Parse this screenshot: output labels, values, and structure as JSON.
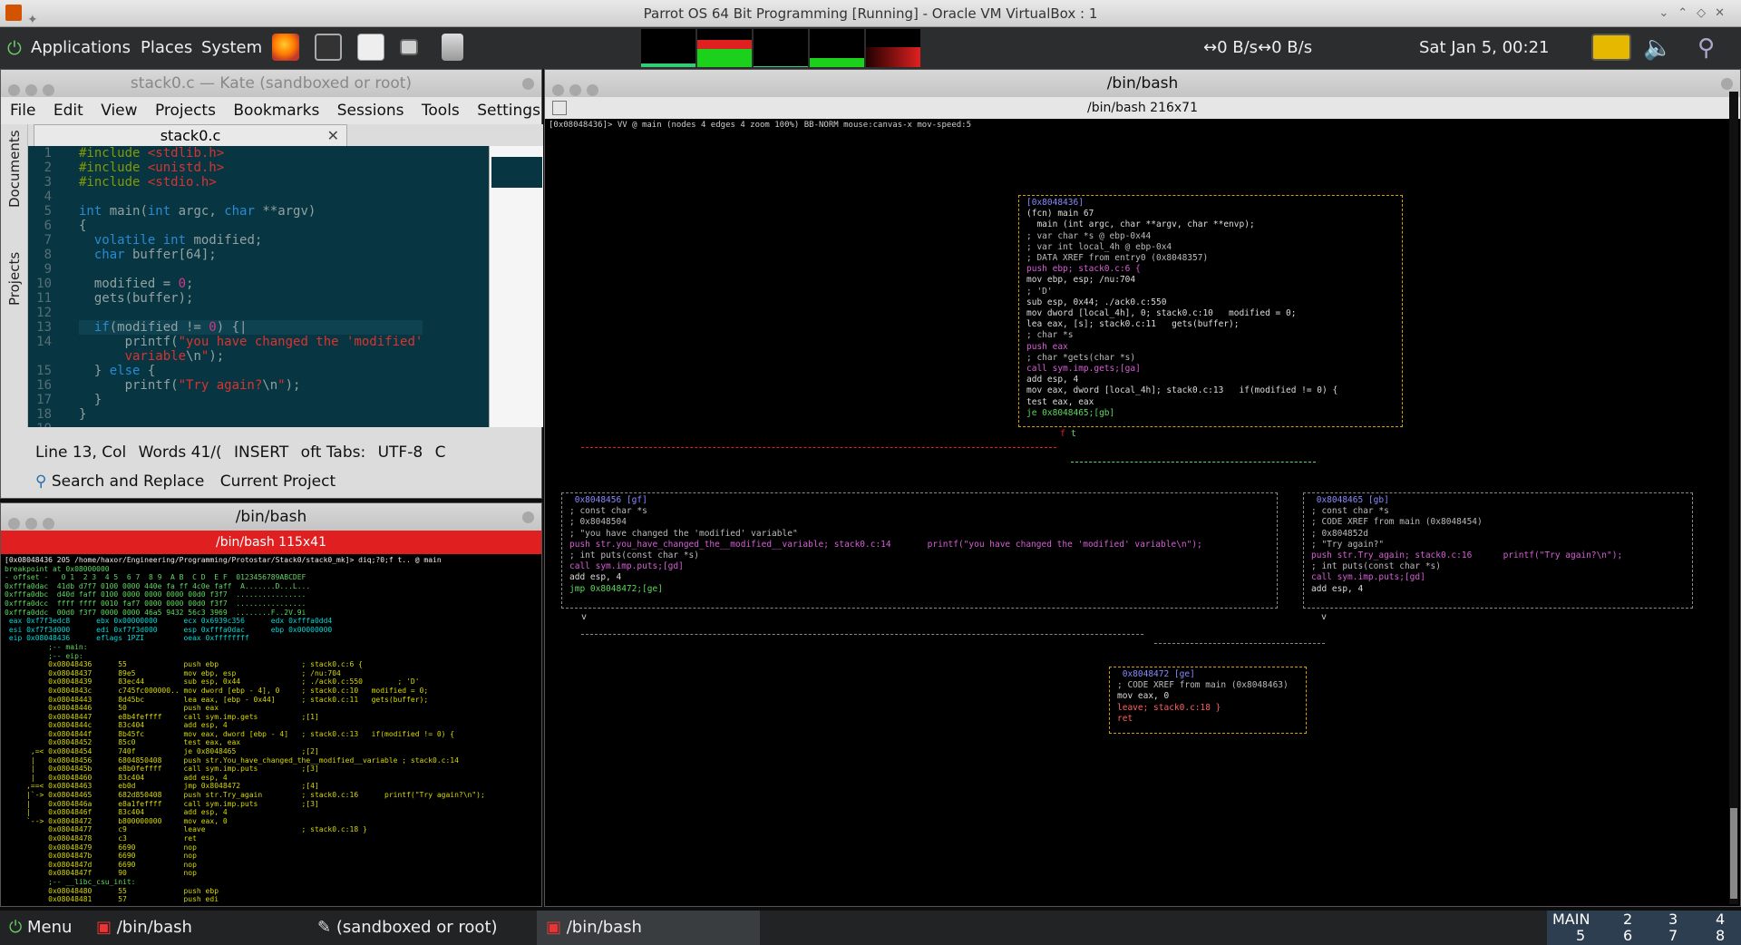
{
  "vbox": {
    "title": "Parrot OS 64 Bit Programming [Running] - Oracle VM VirtualBox : 1"
  },
  "panel": {
    "menus": [
      "Applications",
      "Places",
      "System"
    ],
    "net": "↔0 B/s↔0 B/s",
    "clock": "Sat Jan  5, 00:21"
  },
  "kate": {
    "title": "stack0.c — Kate (sandboxed or root)",
    "menu": [
      "File",
      "Edit",
      "View",
      "Projects",
      "Bookmarks",
      "Sessions",
      "Tools",
      "Settings",
      "»"
    ],
    "side_tabs": [
      "Documents",
      "Projects"
    ],
    "tab": "stack0.c",
    "line_numbers": [
      "1",
      "2",
      "3",
      "4",
      "5",
      "6",
      "7",
      "8",
      "9",
      "10",
      "11",
      "12",
      "13",
      "14",
      "",
      "15",
      "16",
      "17",
      "18",
      "19"
    ],
    "status": {
      "pos": "Line 13, Col",
      "words": "Words 41/(",
      "mode": "INSERT",
      "tabs": "oft Tabs:",
      "encoding": "UTF-8",
      "lang": "C"
    },
    "bottom": {
      "search": "Search and Replace",
      "project": "Current Project"
    }
  },
  "term_left": {
    "title": "/bin/bash",
    "tab": "/bin/bash 115x41",
    "lines": [
      "[0x08048436 205 /home/haxor/Engineering/Programming/Protostar/Stack0/stack0_mk]> diq;?0;f t.. @ main",
      "breakpoint at 0x08000000",
      "- offset -   0 1  2 3  4 5  6 7  8 9  A B  C D  E F  0123456789ABCDEF",
      "0xfffa0dac  41db d7f7 0100 0000 440e fa ff 4c0e faff  A.......D...L...",
      "0xfffa0dbc  d40d faff 0100 0000 0000 0000 00d0 f3f7  ................",
      "0xfffa0dcc  ffff ffff 0010 faf7 0000 0000 00d0 f3f7  ................",
      "0xfffa0ddc  00d0 f3f7 0000 0000 46a5 9432 56c3 3969  ........F..2V.9i",
      " eax 0xf7f3edc8      ebx 0x00000000      ecx 0x6939c356      edx 0xfffa0dd4",
      " esi 0xf7f3d000      edi 0xf7f3d000      esp 0xfffa0dac      ebp 0x00000000",
      " eip 0x08048436      eflags 1PZI         oeax 0xffffffff",
      "          ;-- main:",
      "          ;-- eip:",
      "          0x08048436      55             push ebp                   ; stack0.c:6 {",
      "          0x08048437      89e5           mov ebp, esp               ; /nu:704",
      "          0x08048439      83ec44         sub esp, 0x44              ; ./ack0.c:550        ; 'D'",
      "          0x0804843c      c745fc000000.. mov dword [ebp - 4], 0     ; stack0.c:10   modified = 0;",
      "          0x08048443      8d45bc         lea eax, [ebp - 0x44]      ; stack0.c:11   gets(buffer);",
      "          0x08048446      50             push eax",
      "          0x08048447      e8b4feffff     call sym.imp.gets          ;[1]",
      "          0x0804844c      83c404         add esp, 4",
      "          0x0804844f      8b45fc         mov eax, dword [ebp - 4]   ; stack0.c:13   if(modified != 0) {",
      "          0x08048452      85c0           test eax, eax",
      "      ,=< 0x08048454      740f           je 0x8048465               ;[2]",
      "      |   0x08048456      6804850408     push str.You_have_changed_the__modified__variable ; stack0.c:14",
      "      |   0x0804845b      e8b0feffff     call sym.imp.puts          ;[3]",
      "      |   0x08048460      83c404         add esp, 4",
      "     ,==< 0x08048463      eb0d           jmp 0x8048472              ;[4]",
      "     |`-> 0x08048465      682d850408     push str.Try_again         ; stack0.c:16      printf(\"Try again?\\n\");",
      "     |    0x0804846a      e8a1feffff     call sym.imp.puts          ;[3]",
      "     |    0x0804846f      83c404         add esp, 4",
      "     `--> 0x08048472      b800000000     mov eax, 0",
      "          0x08048477      c9             leave                      ; stack0.c:18 }",
      "          0x08048478      c3             ret",
      "          0x08048479      6690           nop",
      "          0x0804847b      6690           nop",
      "          0x0804847d      6690           nop",
      "          0x0804847f      90             nop",
      "          ;-- __libc_csu_init:",
      "          0x08048480      55             push ebp",
      "          0x08048481      57             push edi",
      "          0x08048482      56             push esi"
    ]
  },
  "term_right": {
    "title": "/bin/bash",
    "tab": "/bin/bash 216x71",
    "status": "[0x08048436]> VV @ main (nodes 4 edges 4 zoom 100%) BB-NORM mouse:canvas-x mov-speed:5",
    "main_block": [
      "[0x8048436]",
      "(fcn) main 67",
      "  main (int argc, char **argv, char **envp);",
      "; var char *s @ ebp-0x44",
      "; var int local_4h @ ebp-0x4",
      "; DATA XREF from entry0 (0x8048357)",
      "push ebp; stack0.c:6 {",
      "mov ebp, esp; /nu:704",
      "; 'D'",
      "sub esp, 0x44; ./ack0.c:550",
      "mov dword [local_4h], 0; stack0.c:10   modified = 0;",
      "lea eax, [s]; stack0.c:11   gets(buffer);",
      "; char *s",
      "push eax",
      "; char *gets(char *s)",
      "call sym.imp.gets;[ga]",
      "add esp, 4",
      "mov eax, dword [local_4h]; stack0.c:13   if(modified != 0) {",
      "test eax, eax",
      "je 0x8048465;[gb]"
    ],
    "left_block": [
      " 0x8048456 [gf]",
      "; const char *s",
      "; 0x8048504",
      "; \"you have changed the 'modified' variable\"",
      "push str.you_have_changed_the__modified__variable; stack0.c:14       printf(\"you have changed the 'modified' variable\\n\");",
      "; int puts(const char *s)",
      "call sym.imp.puts;[gd]",
      "add esp, 4",
      "jmp 0x8048472;[ge]"
    ],
    "right_block": [
      " 0x8048465 [gb]",
      "; const char *s",
      "; CODE XREF from main (0x8048454)",
      "; 0x804852d",
      "; \"Try again?\"",
      "push str.Try_again; stack0.c:16      printf(\"Try again?\\n\");",
      "; int puts(const char *s)",
      "call sym.imp.puts;[gd]",
      "add esp, 4"
    ],
    "end_block": [
      " 0x8048472 [ge]",
      "; CODE XREF from main (0x8048463)",
      "mov eax, 0",
      "leave; stack0.c:18 }",
      "ret"
    ],
    "edge_labels": {
      "f": "f",
      "t": "t",
      "v1": "v",
      "v2": "v"
    }
  },
  "taskbar": {
    "menu": "Menu",
    "tasks": [
      "/bin/bash",
      "(sandboxed or root)",
      "/bin/bash"
    ],
    "workspace_label": "MAIN",
    "workspaces": [
      "2",
      "3",
      "4",
      "5",
      "6",
      "7",
      "8"
    ]
  },
  "colors": {
    "editor_bg": "#073642",
    "accent_red": "#e02020",
    "graph_border": "#d7a000"
  }
}
